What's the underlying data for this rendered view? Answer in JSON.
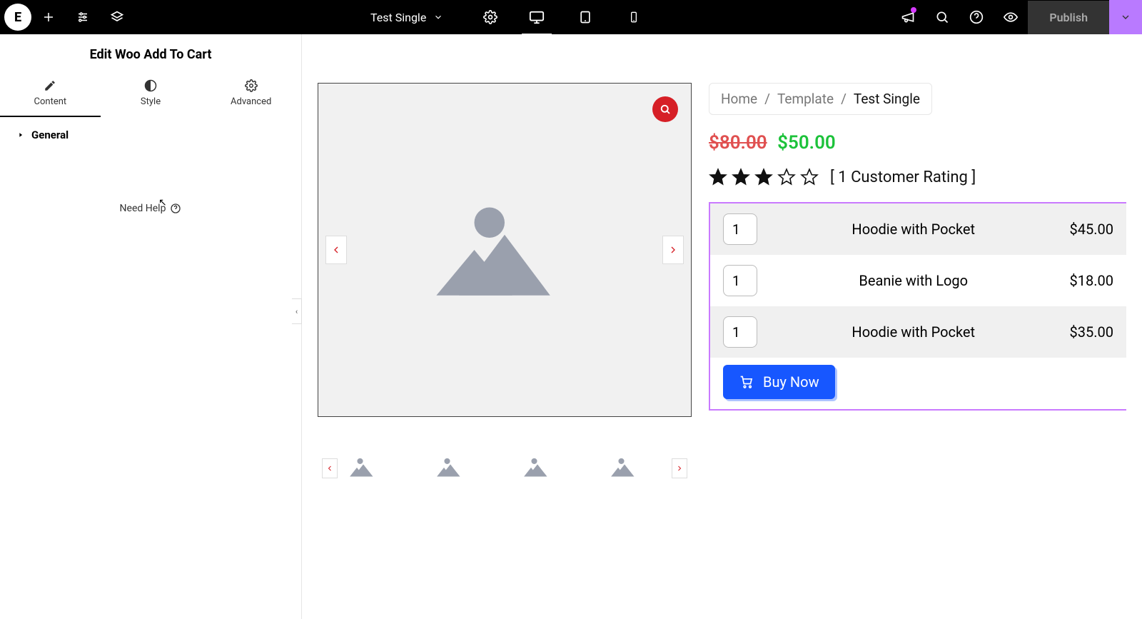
{
  "topbar": {
    "doc_title": "Test Single",
    "publish_label": "Publish"
  },
  "sidebar": {
    "panel_title": "Edit Woo Add To Cart",
    "tabs": {
      "content": "Content",
      "style": "Style",
      "advanced": "Advanced"
    },
    "section_general": "General",
    "need_help": "Need Help"
  },
  "breadcrumb": {
    "items": [
      "Home",
      "Template",
      "Test Single"
    ],
    "sep": "/"
  },
  "product": {
    "price_old": "$80.00",
    "price_new": "$50.00",
    "rating_count_text": "[ 1 Customer Rating ]",
    "stars_filled": 3,
    "stars_total": 5,
    "group": [
      {
        "qty": "1",
        "name": "Hoodie with Pocket",
        "price": "$45.00"
      },
      {
        "qty": "1",
        "name": "Beanie with Logo",
        "price": "$18.00"
      },
      {
        "qty": "1",
        "name": "Hoodie with Pocket",
        "price": "$35.00"
      }
    ],
    "buy_label": "Buy Now"
  }
}
